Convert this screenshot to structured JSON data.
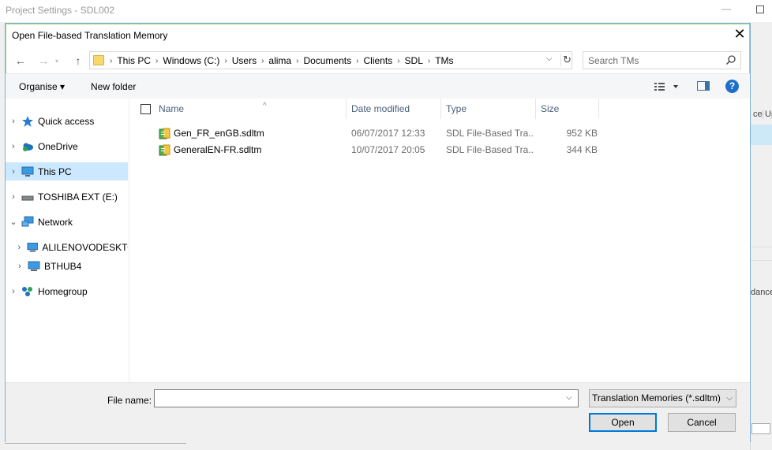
{
  "background": {
    "window_title": "Project Settings - SDL002",
    "minimize_glyph": "—",
    "column_fragment_1": "ce",
    "column_fragment_2": "Up",
    "text_fragment": "dance"
  },
  "dialog": {
    "title": "Open File-based Translation Memory",
    "close_glyph": "✕"
  },
  "navigation": {
    "back_glyph": "←",
    "forward_glyph": "→",
    "up_glyph": "↑"
  },
  "address_bar": {
    "crumbs": [
      "This PC",
      "Windows (C:)",
      "Users",
      "alima",
      "Documents",
      "Clients",
      "SDL",
      "TMs"
    ],
    "separator": "›",
    "dropdown_glyph": "⌵",
    "refresh_glyph": "↻"
  },
  "search": {
    "placeholder": "Search TMs"
  },
  "toolbar": {
    "organise_label": "Organise ▾",
    "new_folder_label": "New folder",
    "help_glyph": "?"
  },
  "nav_pane": {
    "items": [
      {
        "label": "Quick access",
        "chevron": "›",
        "icon": "star-icon"
      },
      {
        "label": "OneDrive",
        "chevron": "›",
        "icon": "cloud-icon"
      },
      {
        "label": "This PC",
        "chevron": "›",
        "icon": "computer-icon",
        "selected": true
      },
      {
        "label": "TOSHIBA EXT (E:)",
        "chevron": "›",
        "icon": "drive-icon"
      },
      {
        "label": "Network",
        "chevron": "⌄",
        "icon": "network-icon"
      },
      {
        "label": "ALILENOVODESKTO",
        "chevron": "›",
        "icon": "monitor-icon"
      },
      {
        "label": "BTHUB4",
        "chevron": "›",
        "icon": "monitor-icon"
      },
      {
        "label": "Homegroup",
        "chevron": "›",
        "icon": "homegroup-icon"
      }
    ]
  },
  "file_list": {
    "columns": {
      "name": "Name",
      "date_modified": "Date modified",
      "type": "Type",
      "size": "Size"
    },
    "sort_glyph": "^",
    "rows": [
      {
        "name": "Gen_FR_enGB.sdltm",
        "date": "06/07/2017 12:33",
        "type": "SDL File-Based Tra...",
        "size": "952 KB"
      },
      {
        "name": "GeneralEN-FR.sdltm",
        "date": "10/07/2017 20:05",
        "type": "SDL File-Based Tra...",
        "size": "344 KB"
      }
    ]
  },
  "bottom": {
    "file_name_label": "File name:",
    "file_name_value": "",
    "dropdown_glyph": "⌵",
    "filter_value": "Translation Memories (*.sdltm)",
    "open_label": "Open",
    "cancel_label": "Cancel"
  },
  "colors": {
    "selection": "#cce8ff",
    "accent": "#0078d7",
    "folder": "#f6d86b"
  }
}
